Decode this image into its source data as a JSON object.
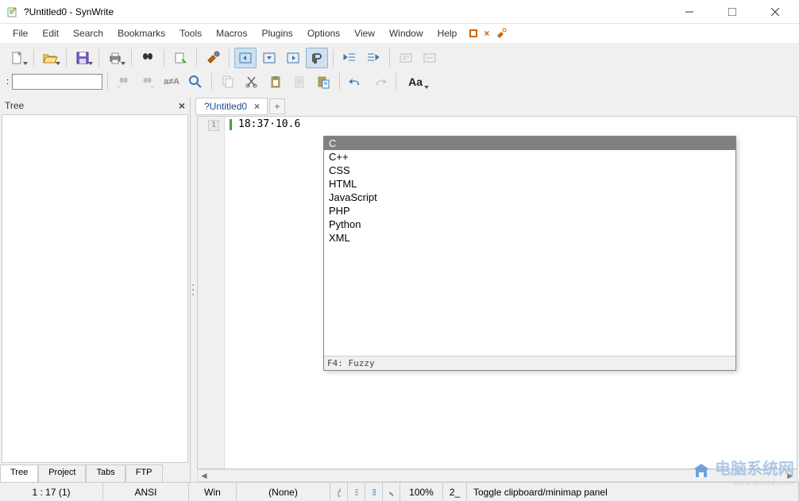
{
  "titlebar": {
    "title": "?Untitled0 - SynWrite"
  },
  "menubar": {
    "items": [
      "File",
      "Edit",
      "Search",
      "Bookmarks",
      "Tools",
      "Macros",
      "Plugins",
      "Options",
      "View",
      "Window",
      "Help"
    ]
  },
  "toolbar2": {
    "label": ":",
    "value": ""
  },
  "sidebar": {
    "title": "Tree",
    "tabs": [
      "Tree",
      "Project",
      "Tabs",
      "FTP"
    ]
  },
  "editor": {
    "tab": "?Untitled0",
    "line_no": "1",
    "content": "18:37·10.6"
  },
  "popup": {
    "items": [
      "C",
      "C++",
      "CSS",
      "HTML",
      "JavaScript",
      "PHP",
      "Python",
      "XML"
    ],
    "footer": "F4: Fuzzy"
  },
  "status": {
    "pos": "1 : 17 (1)",
    "enc": "ANSI",
    "eol": "Win",
    "lexer": "(None)",
    "zoom": "100%",
    "tabmode": "2_",
    "hint": "Toggle clipboard/minimap panel"
  },
  "watermark": {
    "text": "电脑系统网",
    "url": "www.dnxtw.com"
  }
}
